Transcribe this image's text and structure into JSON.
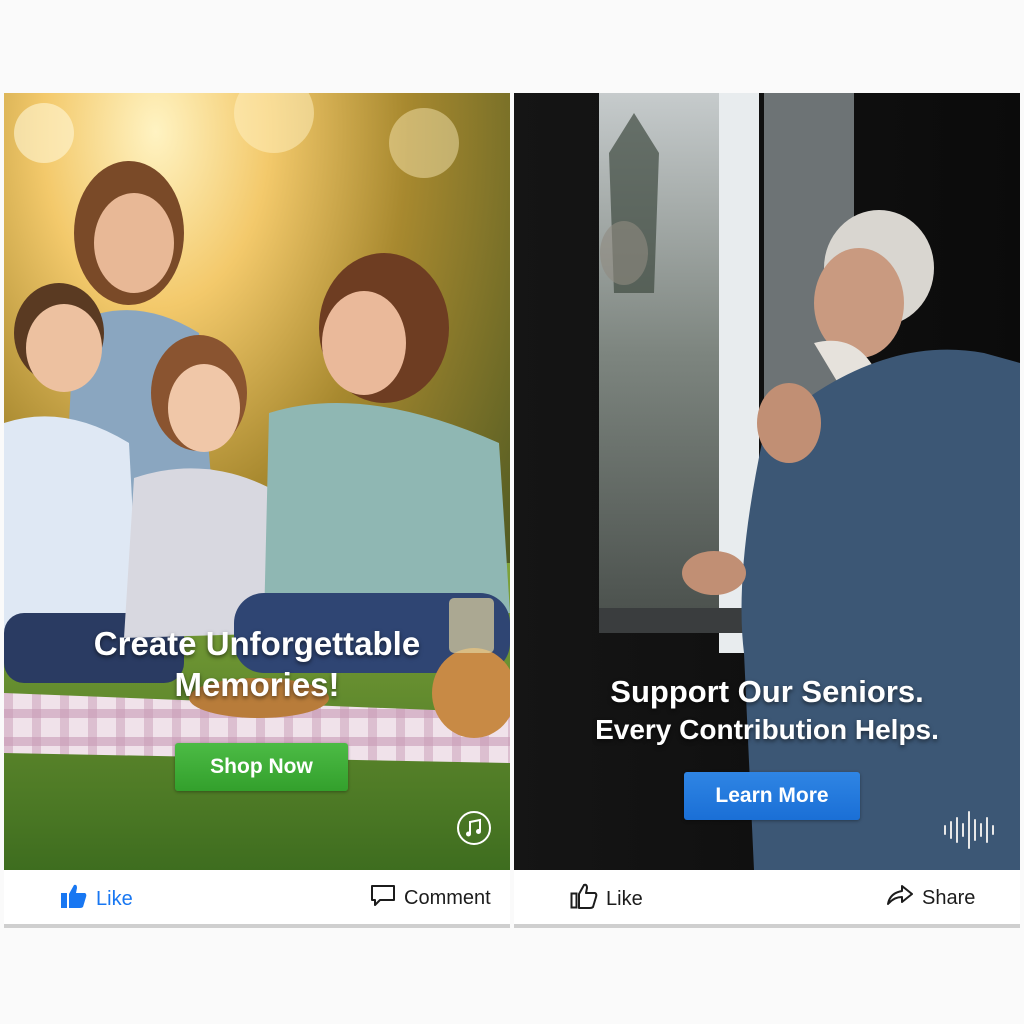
{
  "posts": [
    {
      "headline_lines": [
        "Create Unforgettable",
        "Memories!"
      ],
      "cta_label": "Shop Now",
      "corner_icon": "music-note-icon",
      "actions": [
        {
          "label": "Like",
          "icon": "thumbs-up-filled-icon",
          "active": true
        },
        {
          "label": "Comment",
          "icon": "comment-icon",
          "active": false
        }
      ],
      "colors": {
        "cta": "#3aaa35",
        "active_action": "#1877f2"
      }
    },
    {
      "headline_lines": [
        "Support Our Seniors.",
        "Every Contribution Helps."
      ],
      "cta_label": "Learn More",
      "corner_icon": "audio-waveform-icon",
      "actions": [
        {
          "label": "Like",
          "icon": "thumbs-up-outline-icon",
          "active": false
        },
        {
          "label": "Share",
          "icon": "share-arrow-icon",
          "active": false
        }
      ],
      "colors": {
        "cta": "#2479e0"
      }
    }
  ]
}
